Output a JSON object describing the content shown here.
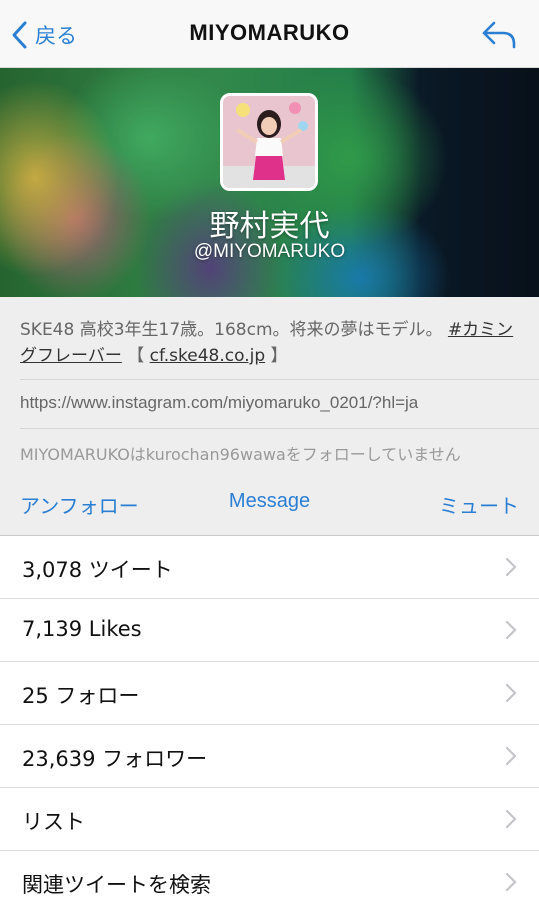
{
  "nav": {
    "back_label": "戻る",
    "title": "MIYOMARUKO"
  },
  "profile": {
    "display_name": "野村実代",
    "handle": "@MIYOMARUKO"
  },
  "bio": {
    "text": "SKE48 高校3年生17歳。168cm。将来の夢はモデル。",
    "hashtag": "#カミングフレーバー",
    "link_open": "【",
    "link": "cf.ske48.co.jp",
    "link_close": "】"
  },
  "website": "https://www.instagram.com/miyomaruko_0201/?hl=ja",
  "follow_status": "MIYOMARUKOはkurochan96wawaをフォローしていません",
  "actions": {
    "unfollow": "アンフォロー",
    "message": "Message",
    "mute": "ミュート"
  },
  "list": [
    {
      "label": "3,078 ツイート"
    },
    {
      "label": "7,139 Likes"
    },
    {
      "label": "25 フォロー"
    },
    {
      "label": "23,639 フォロワー"
    },
    {
      "label": "リスト"
    },
    {
      "label": "関連ツイートを検索"
    }
  ],
  "colors": {
    "accent": "#2a7fd4",
    "info_background": "#eeeeee",
    "secondary_text": "#666666"
  }
}
